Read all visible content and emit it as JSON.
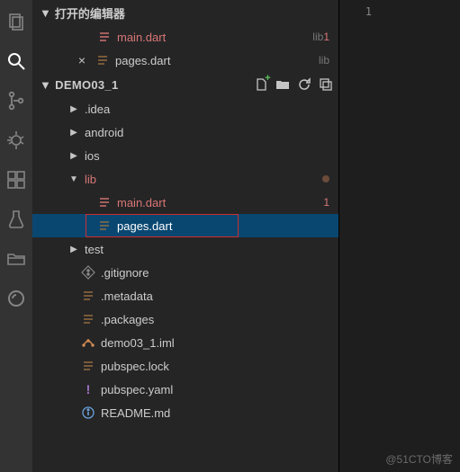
{
  "activityBar": [
    "explorer",
    "search",
    "scm",
    "debug",
    "extensions",
    "test",
    "folder-alt",
    "outline"
  ],
  "openEditors": {
    "title": "打开的编辑器",
    "items": [
      {
        "name": "main.dart",
        "dir": "lib",
        "modified": true,
        "badge": "1",
        "active": false
      },
      {
        "name": "pages.dart",
        "dir": "lib",
        "modified": false,
        "active": true
      }
    ]
  },
  "project": {
    "name": "DEMO03_1",
    "actions": [
      "new-file",
      "new-folder",
      "refresh",
      "collapse"
    ]
  },
  "tree": [
    {
      "type": "folder",
      "name": ".idea",
      "expanded": false,
      "depth": 1
    },
    {
      "type": "folder",
      "name": "android",
      "expanded": false,
      "depth": 1
    },
    {
      "type": "folder",
      "name": "ios",
      "expanded": false,
      "depth": 1
    },
    {
      "type": "folder",
      "name": "lib",
      "expanded": true,
      "depth": 1,
      "modified": true,
      "dot": true
    },
    {
      "type": "file",
      "name": "main.dart",
      "depth": 2,
      "icon": "dart",
      "modified": true,
      "badge": "1"
    },
    {
      "type": "file",
      "name": "pages.dart",
      "depth": 2,
      "icon": "dart",
      "selected": true,
      "highlight": true
    },
    {
      "type": "folder",
      "name": "test",
      "expanded": false,
      "depth": 1
    },
    {
      "type": "file",
      "name": ".gitignore",
      "depth": 1,
      "icon": "git"
    },
    {
      "type": "file",
      "name": ".metadata",
      "depth": 1,
      "icon": "lines"
    },
    {
      "type": "file",
      "name": ".packages",
      "depth": 1,
      "icon": "lines"
    },
    {
      "type": "file",
      "name": "demo03_1.iml",
      "depth": 1,
      "icon": "iml"
    },
    {
      "type": "file",
      "name": "pubspec.lock",
      "depth": 1,
      "icon": "lines"
    },
    {
      "type": "file",
      "name": "pubspec.yaml",
      "depth": 1,
      "icon": "yaml"
    },
    {
      "type": "file",
      "name": "README.md",
      "depth": 1,
      "icon": "info"
    }
  ],
  "editor": {
    "lineNumber": "1"
  },
  "watermark": "@51CTO博客"
}
